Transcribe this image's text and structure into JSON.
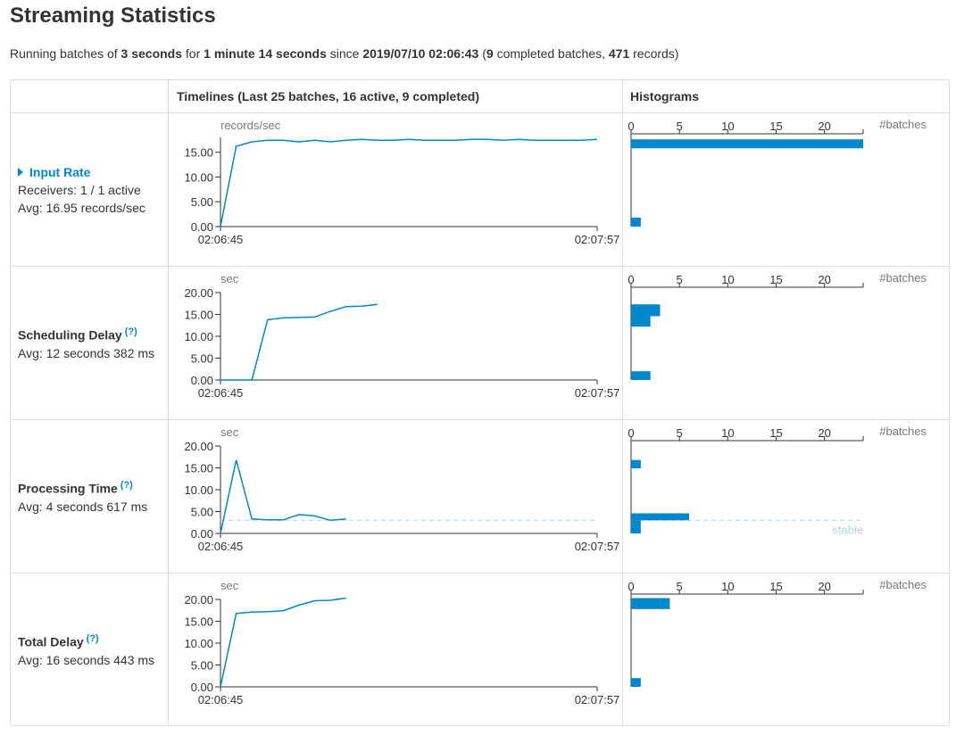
{
  "page": {
    "title": "Streaming Statistics",
    "summary": {
      "p1": "Running batches of ",
      "batch_interval": "3 seconds",
      "p2": " for ",
      "duration": "1 minute 14 seconds",
      "p3": " since ",
      "start_time": "2019/07/10 02:06:43",
      "p4": " (",
      "completed_count": "9",
      "p5": " completed batches, ",
      "records": "471",
      "p6": " records)"
    }
  },
  "table": {
    "header_timelines": "Timelines (Last 25 batches, 16 active, 9 completed)",
    "header_histograms": "Histograms"
  },
  "metrics": [
    {
      "title": "Input Rate",
      "line1": "Receivers: 1 / 1 active",
      "line2": "Avg: 16.95 records/sec",
      "has_help": false,
      "is_link": true,
      "help": ""
    },
    {
      "title": "Scheduling Delay",
      "line1": "Avg: 12 seconds 382 ms",
      "line2": "",
      "has_help": true,
      "is_link": false,
      "help": "(?)"
    },
    {
      "title": "Processing Time",
      "line1": "Avg: 4 seconds 617 ms",
      "line2": "",
      "has_help": true,
      "is_link": false,
      "help": "(?)"
    },
    {
      "title": "Total Delay",
      "line1": "Avg: 16 seconds 443 ms",
      "line2": "",
      "has_help": true,
      "is_link": false,
      "help": "(?)"
    }
  ],
  "colors": {
    "series": "#0088cc",
    "stable": "#afd4ea",
    "axis": "#333333",
    "border": "#dddddd"
  },
  "chart_data": [
    {
      "type": "line",
      "title": "Input Rate timeline",
      "ylabel": "records/sec",
      "ylim": [
        0,
        18
      ],
      "yticks": [
        "0.00",
        "5.00",
        "10.00",
        "15.00"
      ],
      "xticks": [
        "02:06:45",
        "02:07:57"
      ],
      "x": [
        0,
        1,
        2,
        3,
        4,
        5,
        6,
        7,
        8,
        9,
        10,
        11,
        12,
        13,
        14,
        15,
        16,
        17,
        18,
        19,
        20,
        21,
        22,
        23,
        24
      ],
      "values": [
        0,
        16.2,
        17.1,
        17.4,
        17.4,
        17.1,
        17.4,
        17.1,
        17.4,
        17.6,
        17.4,
        17.4,
        17.6,
        17.4,
        17.4,
        17.4,
        17.6,
        17.6,
        17.4,
        17.6,
        17.4,
        17.4,
        17.4,
        17.4,
        17.6
      ]
    },
    {
      "type": "bar",
      "title": "Input Rate histogram",
      "xlabel": "#batches",
      "xlim": [
        0,
        24
      ],
      "xticks": [
        "0",
        "5",
        "10",
        "15",
        "20"
      ],
      "bins": [
        {
          "from": 0,
          "to": 1.8,
          "count": 1
        },
        {
          "from": 15.8,
          "to": 17.6,
          "count": 24
        }
      ]
    },
    {
      "type": "line",
      "title": "Scheduling Delay timeline",
      "ylabel": "sec",
      "ylim": [
        0,
        20
      ],
      "yticks": [
        "0.00",
        "5.00",
        "10.00",
        "15.00",
        "20.00"
      ],
      "xticks": [
        "02:06:45",
        "02:07:57"
      ],
      "x": [
        0,
        1,
        2,
        3,
        4,
        5,
        6,
        7,
        8,
        9
      ],
      "values": [
        0,
        0,
        0,
        13.8,
        14.2,
        14.3,
        14.4,
        15.7,
        16.8,
        16.9,
        17.3
      ]
    },
    {
      "type": "bar",
      "title": "Scheduling Delay histogram",
      "xlabel": "#batches",
      "xlim": [
        0,
        24
      ],
      "xticks": [
        "0",
        "5",
        "10",
        "15",
        "20"
      ],
      "bins": [
        {
          "from": 0,
          "to": 2,
          "count": 2
        },
        {
          "from": 12.2,
          "to": 14.6,
          "count": 2
        },
        {
          "from": 14.6,
          "to": 17.3,
          "count": 3
        }
      ]
    },
    {
      "type": "line",
      "title": "Processing Time timeline",
      "ylabel": "sec",
      "ylim": [
        0,
        20
      ],
      "yticks": [
        "0.00",
        "5.00",
        "10.00",
        "15.00",
        "20.00"
      ],
      "xticks": [
        "02:06:45",
        "02:07:57"
      ],
      "stable_value": 3,
      "stable_label": "stable",
      "x": [
        0,
        1,
        2,
        3,
        4,
        5,
        6,
        7,
        8
      ],
      "values": [
        0,
        16.8,
        3.3,
        3.1,
        3.1,
        4.3,
        4.0,
        3.0,
        3.3
      ]
    },
    {
      "type": "bar",
      "title": "Processing Time histogram",
      "xlabel": "#batches",
      "xlim": [
        0,
        24
      ],
      "xticks": [
        "0",
        "5",
        "10",
        "15",
        "20"
      ],
      "bins": [
        {
          "from": 0,
          "to": 1.6,
          "count": 1
        },
        {
          "from": 1.6,
          "to": 3.0,
          "count": 1
        },
        {
          "from": 3.0,
          "to": 4.6,
          "count": 6
        },
        {
          "from": 14.9,
          "to": 16.8,
          "count": 1
        }
      ]
    },
    {
      "type": "line",
      "title": "Total Delay timeline",
      "ylabel": "sec",
      "ylim": [
        0,
        20
      ],
      "yticks": [
        "0.00",
        "5.00",
        "10.00",
        "15.00",
        "20.00"
      ],
      "xticks": [
        "02:06:45",
        "02:07:57"
      ],
      "x": [
        0,
        1,
        2,
        3,
        4,
        5,
        6,
        7,
        8
      ],
      "values": [
        0,
        16.8,
        17.1,
        17.2,
        17.4,
        18.7,
        19.7,
        19.8,
        20.3
      ]
    },
    {
      "type": "bar",
      "title": "Total Delay histogram",
      "xlabel": "#batches",
      "xlim": [
        0,
        24
      ],
      "xticks": [
        "0",
        "5",
        "10",
        "15",
        "20"
      ],
      "bins": [
        {
          "from": 0,
          "to": 2,
          "count": 1
        },
        {
          "from": 17.8,
          "to": 20.3,
          "count": 4
        }
      ]
    }
  ]
}
